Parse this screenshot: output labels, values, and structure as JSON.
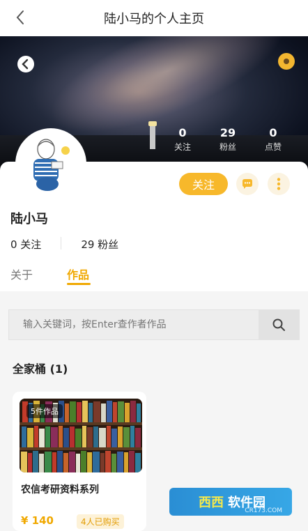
{
  "header": {
    "title": "陆小马的个人主页"
  },
  "profile": {
    "name": "陆小马",
    "stats": [
      {
        "value": "0",
        "label": "关注"
      },
      {
        "value": "29",
        "label": "粉丝"
      },
      {
        "value": "0",
        "label": "点赞"
      }
    ],
    "follow_label": "关注",
    "following_count": "0 关注",
    "fans_count": "29 粉丝"
  },
  "tabs": [
    {
      "label": "关于",
      "active": false
    },
    {
      "label": "作品",
      "active": true
    }
  ],
  "search": {
    "placeholder": "输入关键词，按Enter查作者作品"
  },
  "section": {
    "title": "全家桶 (1)"
  },
  "product": {
    "badge": "5件作品",
    "title": "农信考研资料系列",
    "price": "¥ 140",
    "buyers": "4人已购买"
  },
  "watermark": {
    "brand1": "西西",
    "brand2": "软件园",
    "sub": "CR173.COM"
  },
  "colors": {
    "accent": "#f7b82b",
    "accent_text": "#f0a800"
  }
}
